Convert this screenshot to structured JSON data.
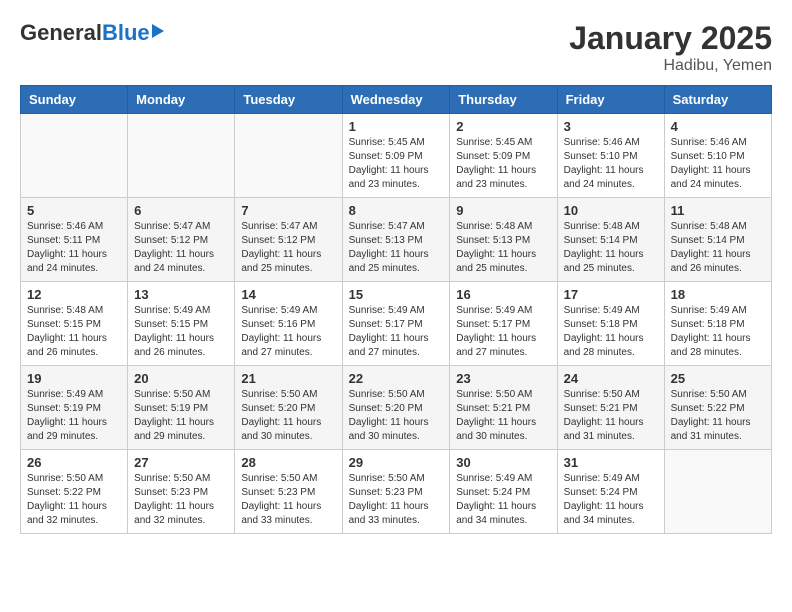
{
  "header": {
    "logo_general": "General",
    "logo_blue": "Blue",
    "month": "January 2025",
    "location": "Hadibu, Yemen"
  },
  "days_of_week": [
    "Sunday",
    "Monday",
    "Tuesday",
    "Wednesday",
    "Thursday",
    "Friday",
    "Saturday"
  ],
  "weeks": [
    {
      "row_bg": "white",
      "days": [
        {
          "num": "",
          "info": ""
        },
        {
          "num": "",
          "info": ""
        },
        {
          "num": "",
          "info": ""
        },
        {
          "num": "1",
          "info": "Sunrise: 5:45 AM\nSunset: 5:09 PM\nDaylight: 11 hours and 23 minutes."
        },
        {
          "num": "2",
          "info": "Sunrise: 5:45 AM\nSunset: 5:09 PM\nDaylight: 11 hours and 23 minutes."
        },
        {
          "num": "3",
          "info": "Sunrise: 5:46 AM\nSunset: 5:10 PM\nDaylight: 11 hours and 24 minutes."
        },
        {
          "num": "4",
          "info": "Sunrise: 5:46 AM\nSunset: 5:10 PM\nDaylight: 11 hours and 24 minutes."
        }
      ]
    },
    {
      "row_bg": "gray",
      "days": [
        {
          "num": "5",
          "info": "Sunrise: 5:46 AM\nSunset: 5:11 PM\nDaylight: 11 hours and 24 minutes."
        },
        {
          "num": "6",
          "info": "Sunrise: 5:47 AM\nSunset: 5:12 PM\nDaylight: 11 hours and 24 minutes."
        },
        {
          "num": "7",
          "info": "Sunrise: 5:47 AM\nSunset: 5:12 PM\nDaylight: 11 hours and 25 minutes."
        },
        {
          "num": "8",
          "info": "Sunrise: 5:47 AM\nSunset: 5:13 PM\nDaylight: 11 hours and 25 minutes."
        },
        {
          "num": "9",
          "info": "Sunrise: 5:48 AM\nSunset: 5:13 PM\nDaylight: 11 hours and 25 minutes."
        },
        {
          "num": "10",
          "info": "Sunrise: 5:48 AM\nSunset: 5:14 PM\nDaylight: 11 hours and 25 minutes."
        },
        {
          "num": "11",
          "info": "Sunrise: 5:48 AM\nSunset: 5:14 PM\nDaylight: 11 hours and 26 minutes."
        }
      ]
    },
    {
      "row_bg": "white",
      "days": [
        {
          "num": "12",
          "info": "Sunrise: 5:48 AM\nSunset: 5:15 PM\nDaylight: 11 hours and 26 minutes."
        },
        {
          "num": "13",
          "info": "Sunrise: 5:49 AM\nSunset: 5:15 PM\nDaylight: 11 hours and 26 minutes."
        },
        {
          "num": "14",
          "info": "Sunrise: 5:49 AM\nSunset: 5:16 PM\nDaylight: 11 hours and 27 minutes."
        },
        {
          "num": "15",
          "info": "Sunrise: 5:49 AM\nSunset: 5:17 PM\nDaylight: 11 hours and 27 minutes."
        },
        {
          "num": "16",
          "info": "Sunrise: 5:49 AM\nSunset: 5:17 PM\nDaylight: 11 hours and 27 minutes."
        },
        {
          "num": "17",
          "info": "Sunrise: 5:49 AM\nSunset: 5:18 PM\nDaylight: 11 hours and 28 minutes."
        },
        {
          "num": "18",
          "info": "Sunrise: 5:49 AM\nSunset: 5:18 PM\nDaylight: 11 hours and 28 minutes."
        }
      ]
    },
    {
      "row_bg": "gray",
      "days": [
        {
          "num": "19",
          "info": "Sunrise: 5:49 AM\nSunset: 5:19 PM\nDaylight: 11 hours and 29 minutes."
        },
        {
          "num": "20",
          "info": "Sunrise: 5:50 AM\nSunset: 5:19 PM\nDaylight: 11 hours and 29 minutes."
        },
        {
          "num": "21",
          "info": "Sunrise: 5:50 AM\nSunset: 5:20 PM\nDaylight: 11 hours and 30 minutes."
        },
        {
          "num": "22",
          "info": "Sunrise: 5:50 AM\nSunset: 5:20 PM\nDaylight: 11 hours and 30 minutes."
        },
        {
          "num": "23",
          "info": "Sunrise: 5:50 AM\nSunset: 5:21 PM\nDaylight: 11 hours and 30 minutes."
        },
        {
          "num": "24",
          "info": "Sunrise: 5:50 AM\nSunset: 5:21 PM\nDaylight: 11 hours and 31 minutes."
        },
        {
          "num": "25",
          "info": "Sunrise: 5:50 AM\nSunset: 5:22 PM\nDaylight: 11 hours and 31 minutes."
        }
      ]
    },
    {
      "row_bg": "white",
      "days": [
        {
          "num": "26",
          "info": "Sunrise: 5:50 AM\nSunset: 5:22 PM\nDaylight: 11 hours and 32 minutes."
        },
        {
          "num": "27",
          "info": "Sunrise: 5:50 AM\nSunset: 5:23 PM\nDaylight: 11 hours and 32 minutes."
        },
        {
          "num": "28",
          "info": "Sunrise: 5:50 AM\nSunset: 5:23 PM\nDaylight: 11 hours and 33 minutes."
        },
        {
          "num": "29",
          "info": "Sunrise: 5:50 AM\nSunset: 5:23 PM\nDaylight: 11 hours and 33 minutes."
        },
        {
          "num": "30",
          "info": "Sunrise: 5:49 AM\nSunset: 5:24 PM\nDaylight: 11 hours and 34 minutes."
        },
        {
          "num": "31",
          "info": "Sunrise: 5:49 AM\nSunset: 5:24 PM\nDaylight: 11 hours and 34 minutes."
        },
        {
          "num": "",
          "info": ""
        }
      ]
    }
  ]
}
